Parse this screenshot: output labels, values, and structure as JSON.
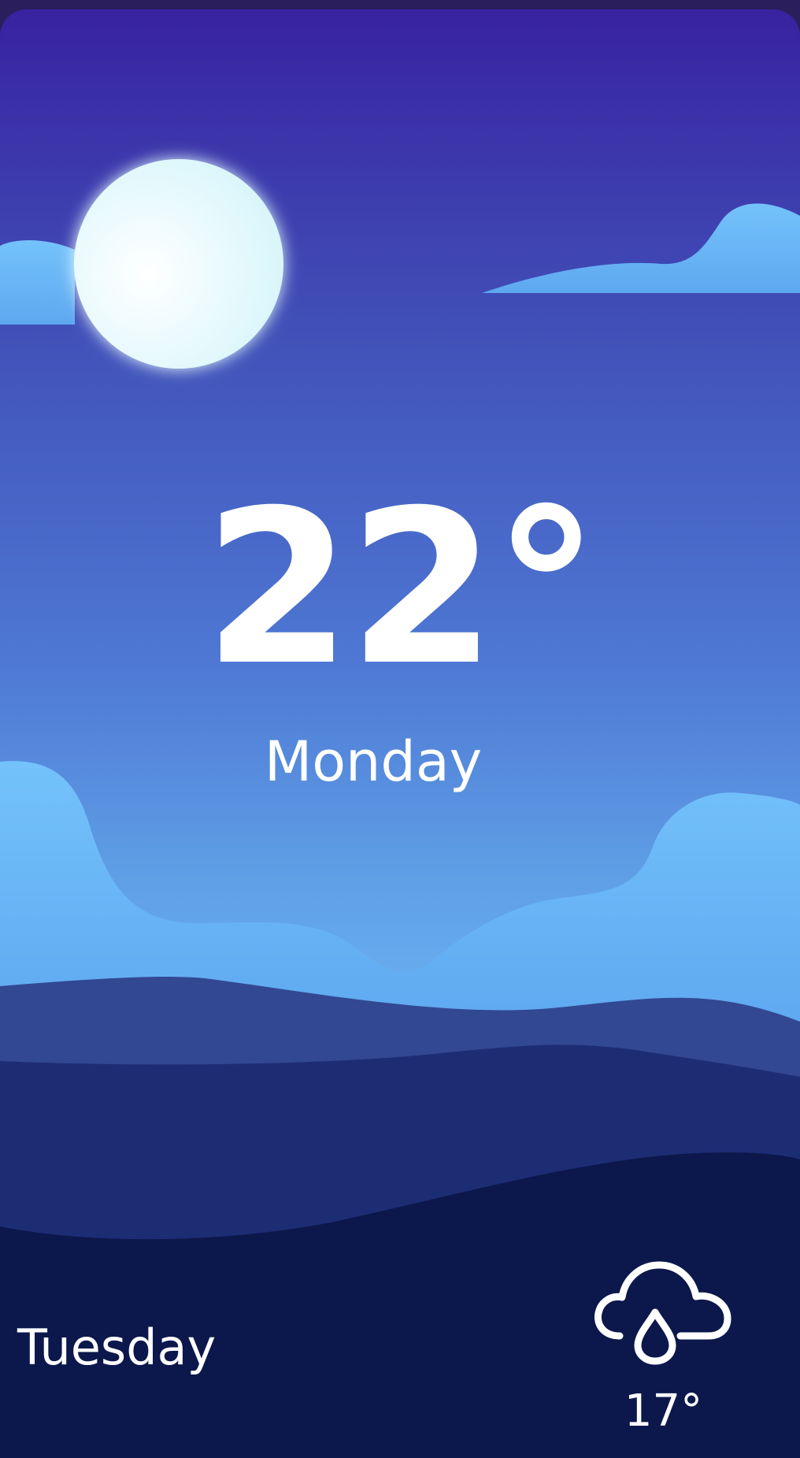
{
  "today": {
    "temperature": "22°",
    "day": "Monday"
  },
  "forecast": [
    {
      "day": "Tuesday",
      "temperature": "17°",
      "icon": "cloud-rain-icon"
    }
  ],
  "colors": {
    "sky_top": "#3822a0",
    "sky_bottom": "#6bb2f2",
    "cloud": "#6bb7f5",
    "moon": "#e6fbfd",
    "hill_light": "#334892",
    "hill_mid": "#1d2d74",
    "ground": "#0c184b"
  }
}
